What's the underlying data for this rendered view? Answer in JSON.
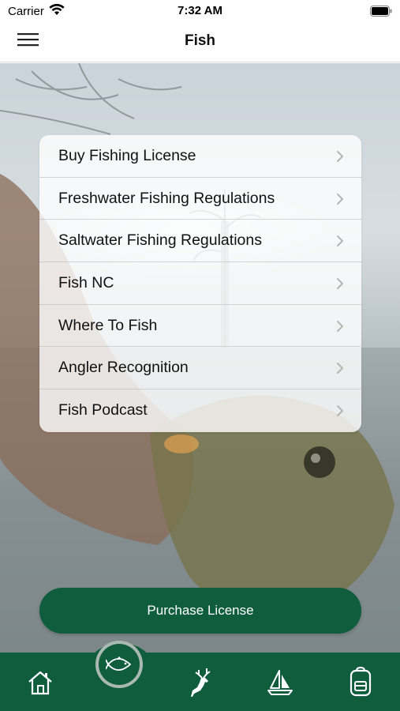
{
  "status_bar": {
    "carrier": "Carrier",
    "time": "7:32 AM",
    "icons": [
      "wifi-icon",
      "battery-icon"
    ]
  },
  "nav": {
    "title": "Fish",
    "menu_icon": "hamburger-menu-icon"
  },
  "menu": {
    "items": [
      {
        "label": "Buy Fishing License"
      },
      {
        "label": "Freshwater Fishing Regulations"
      },
      {
        "label": "Saltwater Fishing Regulations"
      },
      {
        "label": "Fish NC"
      },
      {
        "label": "Where To Fish"
      },
      {
        "label": "Angler Recognition"
      },
      {
        "label": "Fish Podcast"
      }
    ],
    "chevron_icon": "chevron-right-icon"
  },
  "purchase": {
    "label": "Purchase License"
  },
  "tab_bar": {
    "tabs": [
      {
        "icon": "home-icon",
        "selected": false
      },
      {
        "icon": "fish-icon",
        "selected": true
      },
      {
        "icon": "deer-icon",
        "selected": false
      },
      {
        "icon": "sailboat-icon",
        "selected": false
      },
      {
        "icon": "backpack-icon",
        "selected": false
      }
    ]
  },
  "colors": {
    "brand_green": "#0f5d3c",
    "card_bg": "#ffffffcc",
    "text": "#111111"
  }
}
